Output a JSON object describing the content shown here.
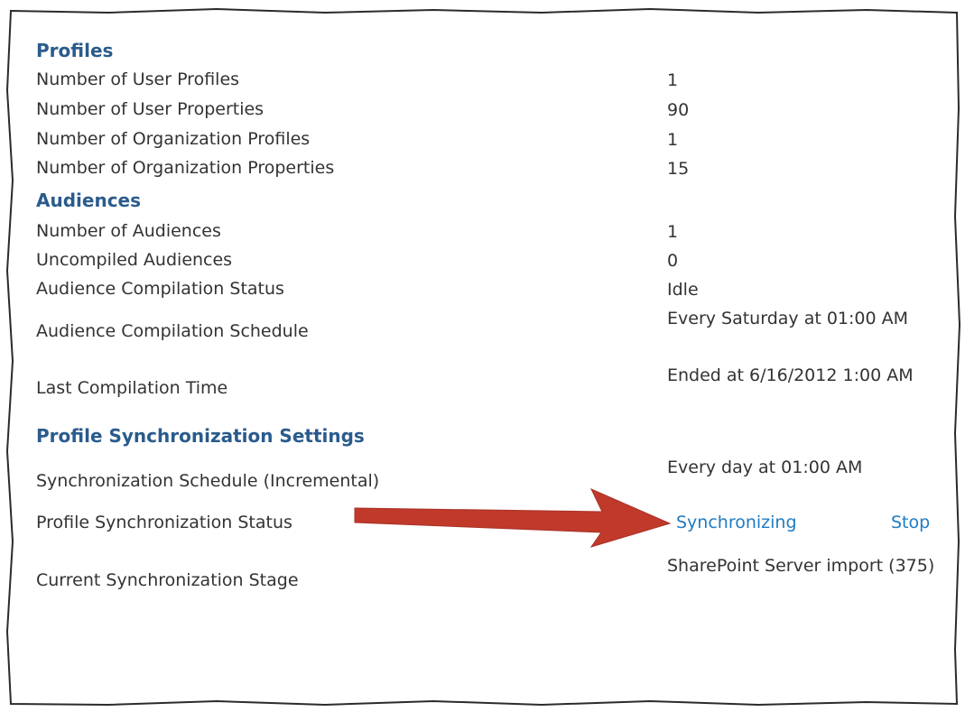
{
  "sections": {
    "profiles": {
      "title": "Profiles",
      "rows": [
        {
          "label": "Number of User Profiles",
          "value": "1"
        },
        {
          "label": "Number of User Properties",
          "value": "90"
        },
        {
          "label": "Number of Organization Profiles",
          "value": "1"
        },
        {
          "label": "Number of Organization Properties",
          "value": "15"
        }
      ]
    },
    "audiences": {
      "title": "Audiences",
      "rows": [
        {
          "label": "Number of Audiences",
          "value": "1"
        },
        {
          "label": "Uncompiled Audiences",
          "value": "0"
        },
        {
          "label": "Audience Compilation Status",
          "value": "Idle"
        },
        {
          "label": "Audience Compilation Schedule",
          "value": "Every Saturday at 01:00 AM"
        },
        {
          "label": "Last Compilation Time",
          "value": "Ended at 6/16/2012 1:00 AM"
        }
      ]
    },
    "sync": {
      "title": "Profile Synchronization Settings",
      "rows": [
        {
          "label": "Synchronization Schedule (Incremental)",
          "value": "Every day at 01:00 AM"
        },
        {
          "label": "Profile Synchronization Status",
          "value": "Synchronizing",
          "action": "Stop"
        },
        {
          "label": "Current Synchronization Stage",
          "value": "SharePoint Server import (375)"
        }
      ]
    }
  },
  "colors": {
    "section_title": "#2a5b8c",
    "link": "#1f7bc2",
    "text": "#333333",
    "arrow": "#c0392b"
  },
  "icons": {
    "annotation": "arrow-right-icon"
  }
}
